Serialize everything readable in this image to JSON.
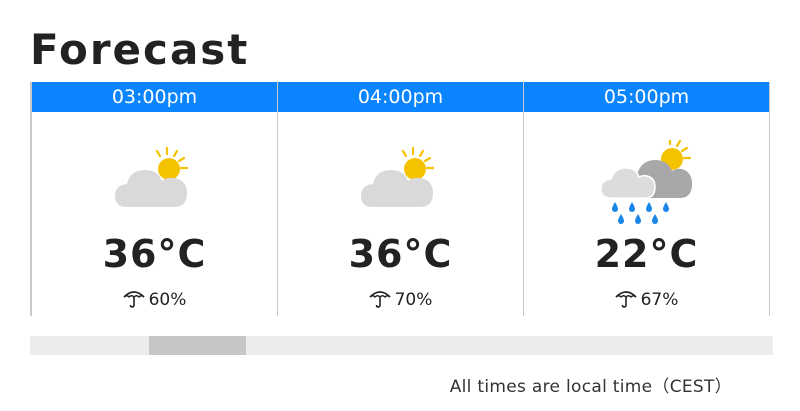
{
  "title": "Forecast",
  "forecast": [
    {
      "time": "03:00pm",
      "icon": "sun-behind-cloud-icon",
      "temperature": "36°C",
      "precipitation": "60%"
    },
    {
      "time": "04:00pm",
      "icon": "sun-behind-cloud-icon",
      "temperature": "36°C",
      "precipitation": "70%"
    },
    {
      "time": "05:00pm",
      "icon": "sun-cloud-rain-icon",
      "temperature": "22°C",
      "precipitation": "67%"
    }
  ],
  "scrollbar": {
    "position": 0.16,
    "visible_fraction": 0.13
  },
  "footnote": "All times are local time（CEST）",
  "colors": {
    "header": "#0a85ff",
    "sun": "#f5c200",
    "cloud": "#d9d9d9",
    "dark_cloud": "#a8a8a8",
    "rain": "#1a86e8"
  }
}
